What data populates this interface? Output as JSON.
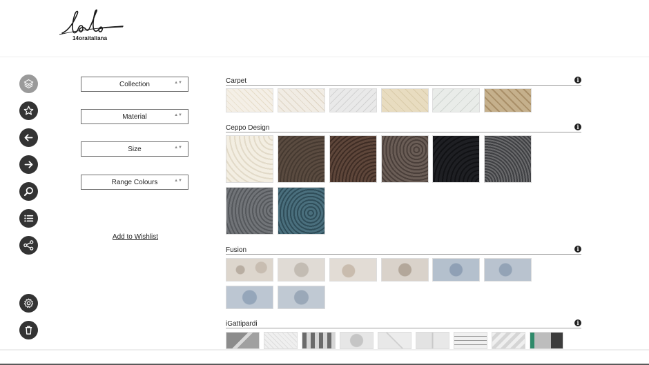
{
  "header": {
    "logo_text": "14oraitaliana"
  },
  "sidebar": {
    "items": [
      {
        "name": "layers",
        "icon": "layers-icon"
      },
      {
        "name": "favorites",
        "icon": "star-icon"
      },
      {
        "name": "back",
        "icon": "arrow-left-icon"
      },
      {
        "name": "forward",
        "icon": "arrow-right-icon"
      },
      {
        "name": "search",
        "icon": "search-icon"
      },
      {
        "name": "list",
        "icon": "list-icon"
      },
      {
        "name": "share",
        "icon": "share-icon"
      },
      {
        "name": "settings",
        "icon": "gear-icon"
      },
      {
        "name": "delete",
        "icon": "trash-icon"
      }
    ]
  },
  "filters": {
    "collection": "Collection",
    "material": "Material",
    "size": "Size",
    "range_colours": "Range Colours",
    "caret": "▲▼",
    "wishlist": "Add to Wishlist"
  },
  "catalog": {
    "info_glyph": "i",
    "sections": [
      {
        "title": "Carpet"
      },
      {
        "title": "Ceppo Design"
      },
      {
        "title": "Fusion"
      },
      {
        "title": "iGattipardi"
      }
    ]
  },
  "colors": {
    "sidebar_icon_bg": "#333333",
    "sidebar_active_bg": "#9a9a9a",
    "section_rule": "#9a9a9a"
  }
}
